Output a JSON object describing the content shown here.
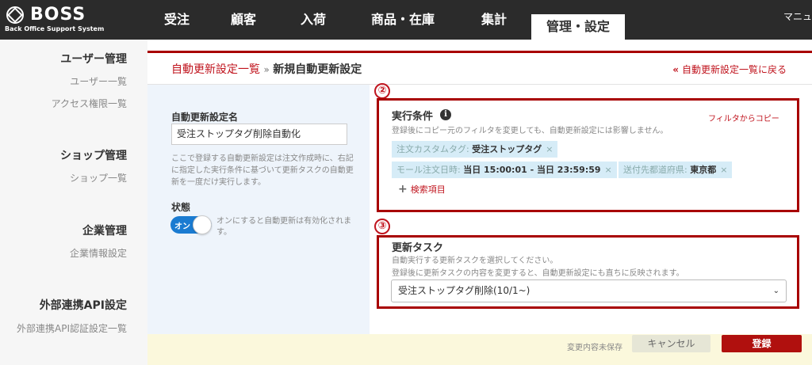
{
  "header": {
    "logo_title": "BOSS",
    "logo_subtitle": "Back Office Support System",
    "tabs": [
      "受注",
      "顧客",
      "入荷",
      "商品・在庫",
      "集計",
      "管理・設定"
    ],
    "manual": "マニュ"
  },
  "sidebar": {
    "user_heading": "ユーザー管理",
    "user_list": "ユーザー一覧",
    "access_list": "アクセス権限一覧",
    "shop_heading": "ショップ管理",
    "shop_list": "ショップ一覧",
    "company_heading": "企業管理",
    "company_info": "企業情報設定",
    "api_heading": "外部連携API設定",
    "api_list": "外部連携API認証設定一覧"
  },
  "breadcrumb": {
    "parent": "自動更新設定一覧",
    "separator": "»",
    "current": "新規自動更新設定"
  },
  "back_link": {
    "chevron": "«",
    "label": "自動更新設定一覧に戻る"
  },
  "form": {
    "name_label": "自動更新設定名",
    "name_value": "受注ストップタグ削除自動化",
    "name_help": "ここで登録する自動更新設定は注文作成時に、右記に指定した実行条件に基づいて更新タスクの自動更新を一度だけ実行します。",
    "status_label": "状態",
    "toggle_label": "オン",
    "toggle_help": "オンにすると自動更新は有効化されます。"
  },
  "conditions": {
    "marker": "②",
    "title": "実行条件",
    "info": "i",
    "copy_link": "フィルタからコピー",
    "note": "登録後にコピー元のフィルタを変更しても、自動更新設定には影響しません。",
    "chips": [
      {
        "key": "注文カスタムタグ: ",
        "value": "受注ストップタグ",
        "x": "×"
      },
      {
        "key": "モール注文日時: ",
        "value": "当日 15:00:01 - 当日 23:59:59",
        "x": "×"
      },
      {
        "key": "送付先都道府県: ",
        "value": "東京都",
        "x": "×"
      }
    ],
    "add_plus": "+",
    "add_label": "検索項目"
  },
  "task": {
    "marker": "③",
    "title": "更新タスク",
    "note1": "自動実行する更新タスクを選択してください。",
    "note2": "登録後に更新タスクの内容を変更すると、自動更新設定にも直ちに反映されます。",
    "selected": "受注ストップタグ削除(10/1~)",
    "caret": "⌄"
  },
  "footer": {
    "unsaved": "変更内容未保存",
    "cancel": "キャンセル",
    "submit": "登録"
  },
  "colors": {
    "header_bg": "#2b2b2b",
    "accent_red": "#c0141e",
    "border_red": "#a80000",
    "toggle_blue": "#1a7bd1",
    "chip_bg": "#d6ecf7",
    "footer_bg": "#fbf8dc"
  }
}
